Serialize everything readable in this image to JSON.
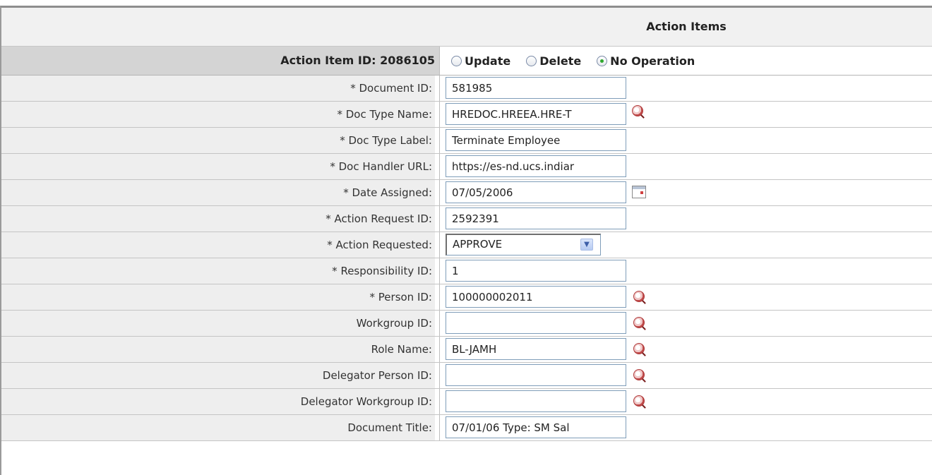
{
  "panel": {
    "title": "Action Items",
    "item_label": "Action Item ID: 2086105",
    "operations": [
      {
        "label": "Update",
        "checked": false
      },
      {
        "label": "Delete",
        "checked": false
      },
      {
        "label": "No Operation",
        "checked": true
      }
    ]
  },
  "fields": {
    "document_id": {
      "label": "* Document ID:",
      "value": "581985"
    },
    "doc_type_name": {
      "label": "* Doc Type Name:",
      "value": "HREDOC.HREEA.HRE-T"
    },
    "doc_type_label": {
      "label": "* Doc Type Label:",
      "value": "Terminate Employee"
    },
    "doc_handler_url": {
      "label": "* Doc Handler URL:",
      "value": "https://es-nd.ucs.indiar"
    },
    "date_assigned": {
      "label": "* Date Assigned:",
      "value": "07/05/2006"
    },
    "action_request_id": {
      "label": "* Action Request ID:",
      "value": "2592391"
    },
    "action_requested": {
      "label": "* Action Requested:",
      "value": "APPROVE"
    },
    "responsibility_id": {
      "label": "* Responsibility ID:",
      "value": "1"
    },
    "person_id": {
      "label": "* Person ID:",
      "value": "100000002011"
    },
    "workgroup_id": {
      "label": "Workgroup ID:",
      "value": ""
    },
    "role_name": {
      "label": "Role Name:",
      "value": "BL-JAMH"
    },
    "delegator_person_id": {
      "label": "Delegator Person ID:",
      "value": ""
    },
    "delegator_workgroup_id": {
      "label": "Delegator Workgroup ID:",
      "value": ""
    },
    "document_title": {
      "label": "Document Title:",
      "value": "07/01/06 Type: SM Sal"
    }
  },
  "icons": {
    "lookup": "magnifier-lookup-icon",
    "calendar": "calendar-icon",
    "dropdown": "chevron-down-icon"
  }
}
